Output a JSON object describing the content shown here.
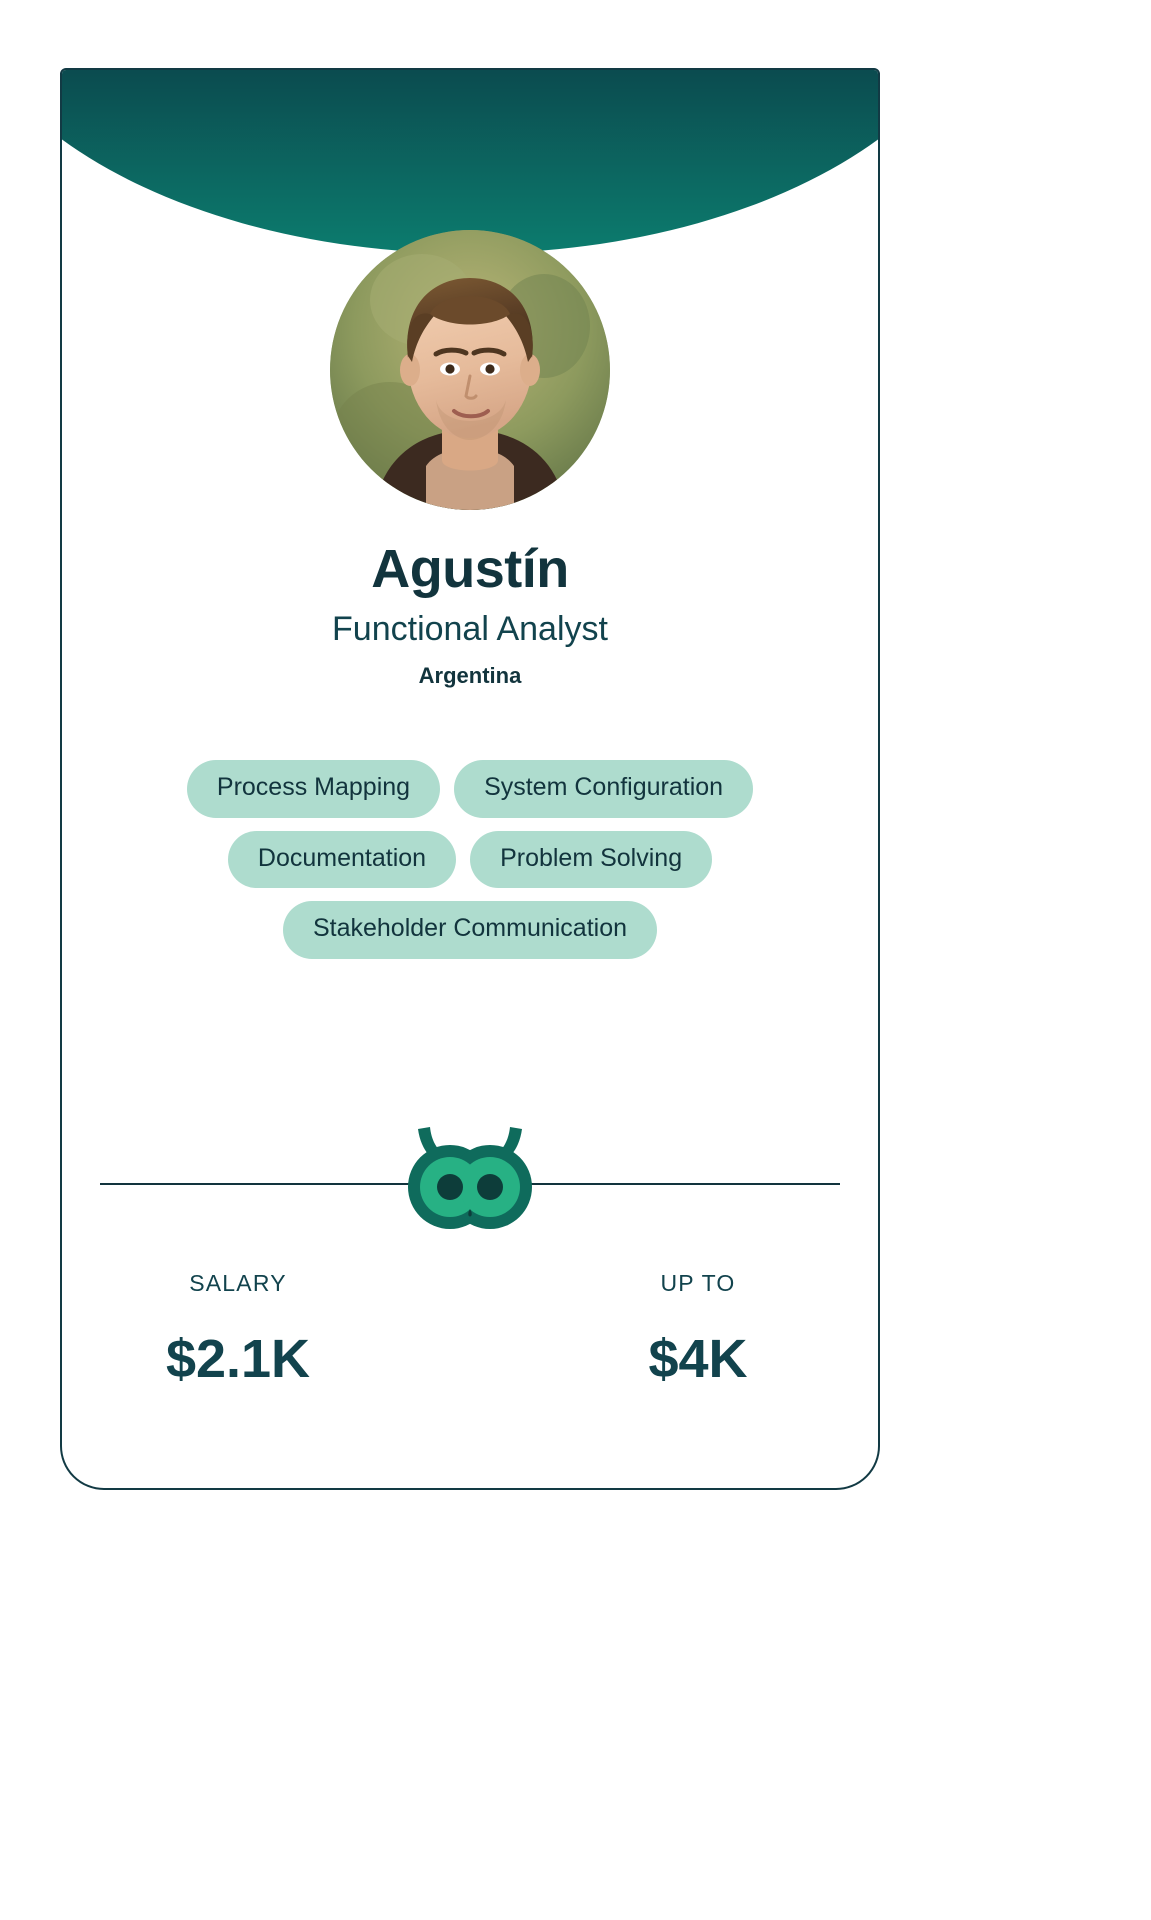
{
  "card": {
    "header": {
      "gradient_from": "#0b4b4f",
      "gradient_to": "#0c7c6e",
      "shape": "ellipse-bottom-curve"
    },
    "avatar": {
      "icon": "profile-photo",
      "alt": "Portrait photo of Agustín"
    },
    "profile": {
      "name": "Agustín",
      "role": "Functional Analyst",
      "country": "Argentina"
    },
    "skills": [
      "Process Mapping",
      "System Configuration",
      "Documentation",
      "Problem Solving",
      "Stakeholder Communication"
    ],
    "brand": {
      "icon": "owl-logo",
      "color_outline": "#0f6b5c",
      "color_fill": "#27b184",
      "color_pupil": "#0d3d3a"
    },
    "compensation": {
      "base": {
        "label": "SALARY",
        "value": "$2.1K"
      },
      "max": {
        "label": "UP TO",
        "value": "$4K"
      }
    }
  },
  "theme": {
    "text_dark": "#12343d",
    "pill_bg": "#aedcce",
    "border": "#123a44"
  }
}
